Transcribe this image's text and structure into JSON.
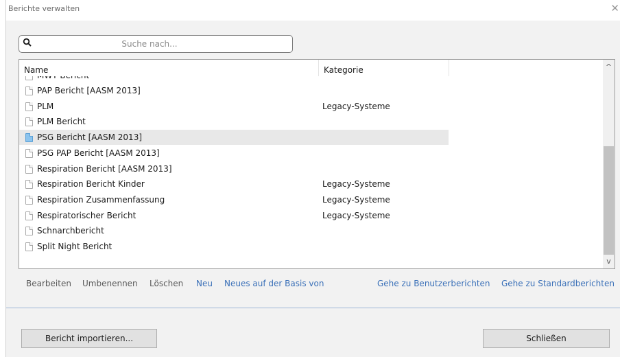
{
  "window": {
    "title": "Berichte verwalten",
    "close_glyph": "✕"
  },
  "search": {
    "placeholder": "Suche nach...",
    "value": "",
    "icon": "search-icon"
  },
  "table": {
    "columns": [
      "Name",
      "Kategorie"
    ],
    "partial_row": "MWT Bericht",
    "rows": [
      {
        "name": "PAP Bericht [AASM 2013]",
        "category": "",
        "selected": false
      },
      {
        "name": "PLM",
        "category": "Legacy-Systeme",
        "selected": false
      },
      {
        "name": "PLM Bericht",
        "category": "",
        "selected": false
      },
      {
        "name": "PSG Bericht [AASM 2013]",
        "category": "",
        "selected": true
      },
      {
        "name": "PSG PAP Bericht [AASM 2013]",
        "category": "",
        "selected": false
      },
      {
        "name": "Respiration Bericht [AASM 2013]",
        "category": "",
        "selected": false
      },
      {
        "name": "Respiration Bericht Kinder",
        "category": "Legacy-Systeme",
        "selected": false
      },
      {
        "name": "Respiration Zusammenfassung",
        "category": "Legacy-Systeme",
        "selected": false
      },
      {
        "name": "Respiratorischer Bericht",
        "category": "Legacy-Systeme",
        "selected": false
      },
      {
        "name": "Schnarchbericht",
        "category": "",
        "selected": false
      },
      {
        "name": "Split Night Bericht",
        "category": "",
        "selected": false
      }
    ]
  },
  "scrollbar": {
    "up_glyph": "^",
    "down_glyph": "v"
  },
  "actions": {
    "edit": "Bearbeiten",
    "rename": "Umbenennen",
    "delete": "Löschen",
    "new": "Neu",
    "new_based_on": "Neues auf der Basis von",
    "goto_user": "Gehe zu Benutzerberichten",
    "goto_standard": "Gehe zu Standardberichten"
  },
  "buttons": {
    "import": "Bericht importieren...",
    "close": "Schließen"
  },
  "colors": {
    "link_blue": "#3a70b8",
    "disabled_gray": "#5a5a5a",
    "selection": "#e8e8e8",
    "selected_icon": "#8cc4ee"
  }
}
